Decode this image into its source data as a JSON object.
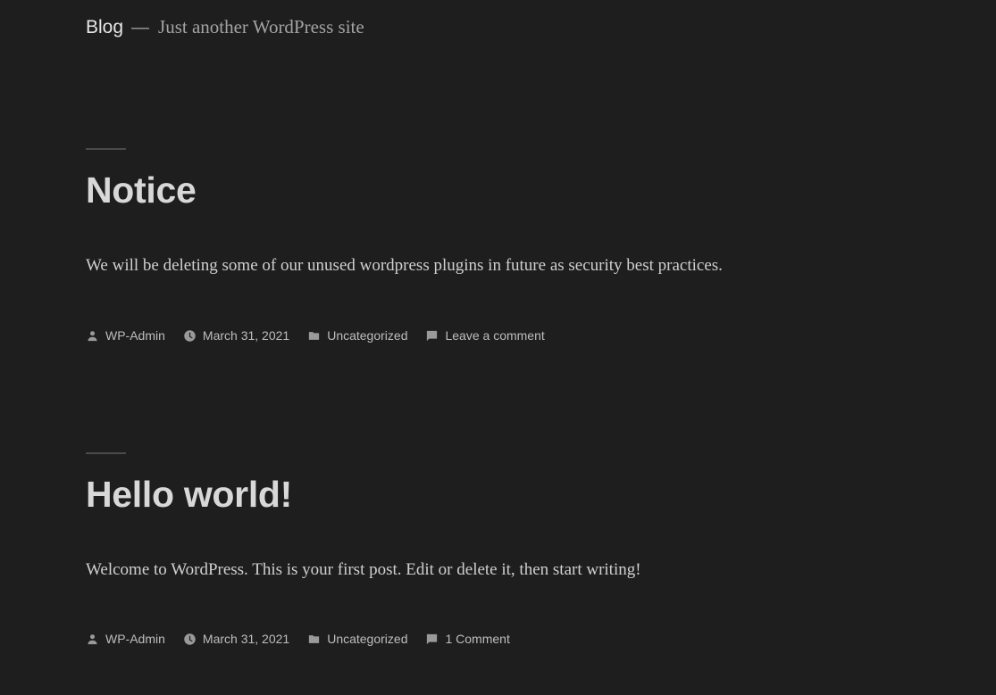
{
  "header": {
    "site_title": "Blog",
    "separator": "—",
    "tagline": "Just another WordPress site"
  },
  "posts": [
    {
      "title": "Notice",
      "excerpt": "We will be deleting some of our unused wordpress plugins in future as security best practices.",
      "author": "WP-Admin",
      "date": "March 31, 2021",
      "category": "Uncategorized",
      "comments": "Leave a comment"
    },
    {
      "title": "Hello world!",
      "excerpt": "Welcome to WordPress. This is your first post. Edit or delete it, then start writing!",
      "author": "WP-Admin",
      "date": "March 31, 2021",
      "category": "Uncategorized",
      "comments": "1 Comment"
    }
  ],
  "icons": {
    "author": "person-icon",
    "date": "clock-icon",
    "category": "folder-icon",
    "comments": "comment-icon"
  },
  "colors": {
    "background": "#1e1e1e",
    "title": "#d8d8d8",
    "meta": "#bdbdbd"
  }
}
